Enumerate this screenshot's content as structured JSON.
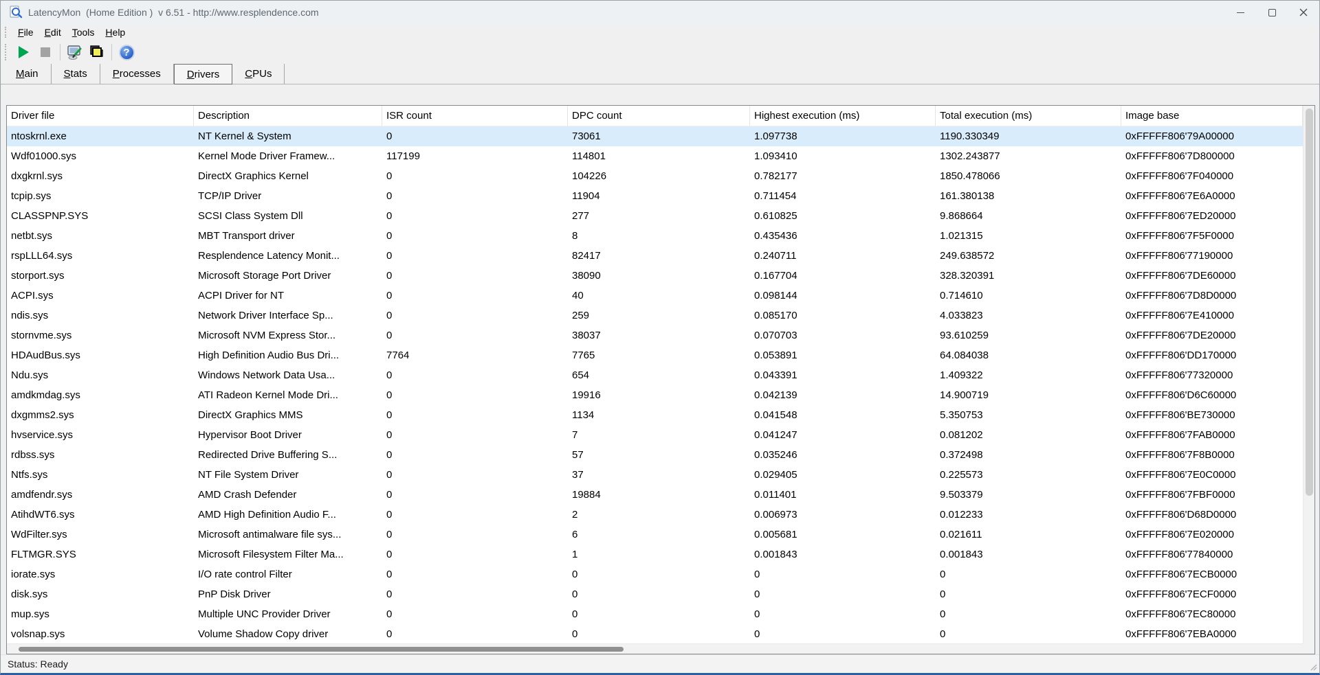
{
  "window": {
    "title": "LatencyMon  (Home Edition )  v 6.51 - http://www.resplendence.com"
  },
  "menu": {
    "items": [
      "File",
      "Edit",
      "Tools",
      "Help"
    ]
  },
  "toolbar": {
    "buttons": [
      {
        "name": "start-button",
        "icon": "play-icon"
      },
      {
        "name": "stop-button",
        "icon": "stop-icon"
      },
      {
        "name": "options-button",
        "icon": "monitor-pen-icon"
      },
      {
        "name": "windows-view-button",
        "icon": "stacked-squares-icon"
      },
      {
        "name": "help-button",
        "icon": "question-mark-icon",
        "glyph": "?"
      }
    ]
  },
  "tabs": {
    "items": [
      "Main",
      "Stats",
      "Processes",
      "Drivers",
      "CPUs"
    ],
    "selected": "Drivers"
  },
  "table": {
    "columns": [
      "Driver file",
      "Description",
      "ISR count",
      "DPC count",
      "Highest execution (ms)",
      "Total execution (ms)",
      "Image base"
    ],
    "selected_row_index": 0,
    "rows": [
      [
        "ntoskrnl.exe",
        "NT Kernel & System",
        "0",
        "73061",
        "1.097738",
        "1190.330349",
        "0xFFFFF806'79A00000"
      ],
      [
        "Wdf01000.sys",
        "Kernel Mode Driver Framew...",
        "117199",
        "114801",
        "1.093410",
        "1302.243877",
        "0xFFFFF806'7D800000"
      ],
      [
        "dxgkrnl.sys",
        "DirectX Graphics Kernel",
        "0",
        "104226",
        "0.782177",
        "1850.478066",
        "0xFFFFF806'7F040000"
      ],
      [
        "tcpip.sys",
        "TCP/IP Driver",
        "0",
        "11904",
        "0.711454",
        "161.380138",
        "0xFFFFF806'7E6A0000"
      ],
      [
        "CLASSPNP.SYS",
        "SCSI Class System Dll",
        "0",
        "277",
        "0.610825",
        "9.868664",
        "0xFFFFF806'7ED20000"
      ],
      [
        "netbt.sys",
        "MBT Transport driver",
        "0",
        "8",
        "0.435436",
        "1.021315",
        "0xFFFFF806'7F5F0000"
      ],
      [
        "rspLLL64.sys",
        "Resplendence Latency Monit...",
        "0",
        "82417",
        "0.240711",
        "249.638572",
        "0xFFFFF806'77190000"
      ],
      [
        "storport.sys",
        "Microsoft Storage Port Driver",
        "0",
        "38090",
        "0.167704",
        "328.320391",
        "0xFFFFF806'7DE60000"
      ],
      [
        "ACPI.sys",
        "ACPI Driver for NT",
        "0",
        "40",
        "0.098144",
        "0.714610",
        "0xFFFFF806'7D8D0000"
      ],
      [
        "ndis.sys",
        "Network Driver Interface Sp...",
        "0",
        "259",
        "0.085170",
        "4.033823",
        "0xFFFFF806'7E410000"
      ],
      [
        "stornvme.sys",
        "Microsoft NVM Express Stor...",
        "0",
        "38037",
        "0.070703",
        "93.610259",
        "0xFFFFF806'7DE20000"
      ],
      [
        "HDAudBus.sys",
        "High Definition Audio Bus Dri...",
        "7764",
        "7765",
        "0.053891",
        "64.084038",
        "0xFFFFF806'DD170000"
      ],
      [
        "Ndu.sys",
        "Windows Network Data Usa...",
        "0",
        "654",
        "0.043391",
        "1.409322",
        "0xFFFFF806'77320000"
      ],
      [
        "amdkmdag.sys",
        "ATI Radeon Kernel Mode Dri...",
        "0",
        "19916",
        "0.042139",
        "14.900719",
        "0xFFFFF806'D6C60000"
      ],
      [
        "dxgmms2.sys",
        "DirectX Graphics MMS",
        "0",
        "1134",
        "0.041548",
        "5.350753",
        "0xFFFFF806'BE730000"
      ],
      [
        "hvservice.sys",
        "Hypervisor Boot Driver",
        "0",
        "7",
        "0.041247",
        "0.081202",
        "0xFFFFF806'7FAB0000"
      ],
      [
        "rdbss.sys",
        "Redirected Drive Buffering S...",
        "0",
        "57",
        "0.035246",
        "0.372498",
        "0xFFFFF806'7F8B0000"
      ],
      [
        "Ntfs.sys",
        "NT File System Driver",
        "0",
        "37",
        "0.029405",
        "0.225573",
        "0xFFFFF806'7E0C0000"
      ],
      [
        "amdfendr.sys",
        "AMD Crash Defender",
        "0",
        "19884",
        "0.011401",
        "9.503379",
        "0xFFFFF806'7FBF0000"
      ],
      [
        "AtihdWT6.sys",
        "AMD High Definition Audio F...",
        "0",
        "2",
        "0.006973",
        "0.012233",
        "0xFFFFF806'D68D0000"
      ],
      [
        "WdFilter.sys",
        "Microsoft antimalware file sys...",
        "0",
        "6",
        "0.005681",
        "0.021611",
        "0xFFFFF806'7E020000"
      ],
      [
        "FLTMGR.SYS",
        "Microsoft Filesystem Filter Ma...",
        "0",
        "1",
        "0.001843",
        "0.001843",
        "0xFFFFF806'77840000"
      ],
      [
        "iorate.sys",
        "I/O rate control Filter",
        "0",
        "0",
        "0",
        "0",
        "0xFFFFF806'7ECB0000"
      ],
      [
        "disk.sys",
        "PnP Disk Driver",
        "0",
        "0",
        "0",
        "0",
        "0xFFFFF806'7ECF0000"
      ],
      [
        "mup.sys",
        "Multiple UNC Provider Driver",
        "0",
        "0",
        "0",
        "0",
        "0xFFFFF806'7EC80000"
      ],
      [
        "volsnap.sys",
        "Volume Shadow Copy driver",
        "0",
        "0",
        "0",
        "0",
        "0xFFFFF806'7EBA0000"
      ]
    ]
  },
  "status_bar": {
    "text": "Status: Ready"
  },
  "colors": {
    "selection": "#d9ecfb",
    "play_green": "#00a550",
    "stop_gray": "#a3a3a3",
    "help_blue": "#2e62c9",
    "stack_yellow": "#f2ee55",
    "title_text": "#5d6770"
  }
}
